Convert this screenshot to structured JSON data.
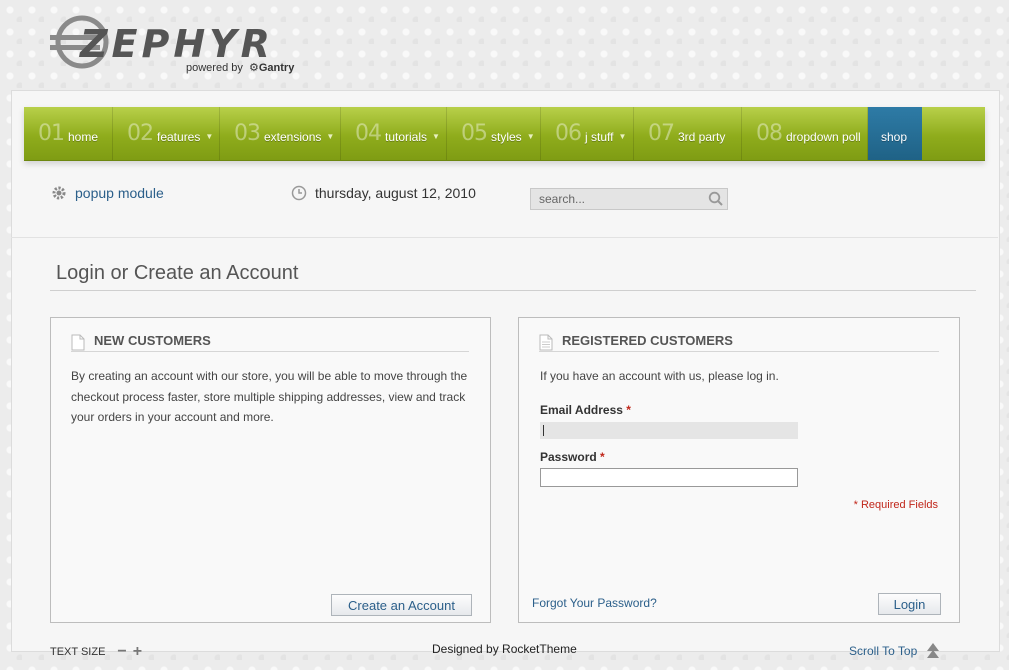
{
  "logo": {
    "brand": "ZEPHYR",
    "powered_by": "powered by",
    "gantry": "Gantry"
  },
  "menu": [
    {
      "num": "01",
      "label": "home",
      "dropdown": false
    },
    {
      "num": "02",
      "label": "features",
      "dropdown": true
    },
    {
      "num": "03",
      "label": "extensions",
      "dropdown": true
    },
    {
      "num": "04",
      "label": "tutorials",
      "dropdown": true
    },
    {
      "num": "05",
      "label": "styles",
      "dropdown": true
    },
    {
      "num": "06",
      "label": "j stuff",
      "dropdown": true
    },
    {
      "num": "07",
      "label": "3rd party",
      "dropdown": false
    },
    {
      "num": "08",
      "label": "dropdown poll",
      "dropdown": false
    },
    {
      "num": "",
      "label": "shop",
      "dropdown": false
    }
  ],
  "subbar": {
    "popup": "popup module",
    "date": "thursday, august 12, 2010",
    "search_placeholder": "search..."
  },
  "page_title": "Login or Create an Account",
  "new_customers": {
    "heading": "NEW CUSTOMERS",
    "text": "By creating an account with our store, you will be able to move through the checkout process faster, store multiple shipping addresses, view and track your orders in your account and more.",
    "button": "Create an Account"
  },
  "registered": {
    "heading": "REGISTERED CUSTOMERS",
    "intro": "If you have an account with us, please log in.",
    "email_label": "Email Address",
    "password_label": "Password",
    "required_marker": "*",
    "required_note": "* Required Fields",
    "forgot": "Forgot Your Password?",
    "login_button": "Login",
    "email_value": "",
    "password_value": ""
  },
  "footer": {
    "text_size": "TEXT SIZE",
    "designed": "Designed by RocketTheme",
    "scroll_top": "Scroll To Top"
  },
  "colors": {
    "menu_green": "#8fac1c",
    "shop_blue": "#1f6286",
    "link_blue": "#2b5f8a",
    "required_red": "#c0261a"
  }
}
